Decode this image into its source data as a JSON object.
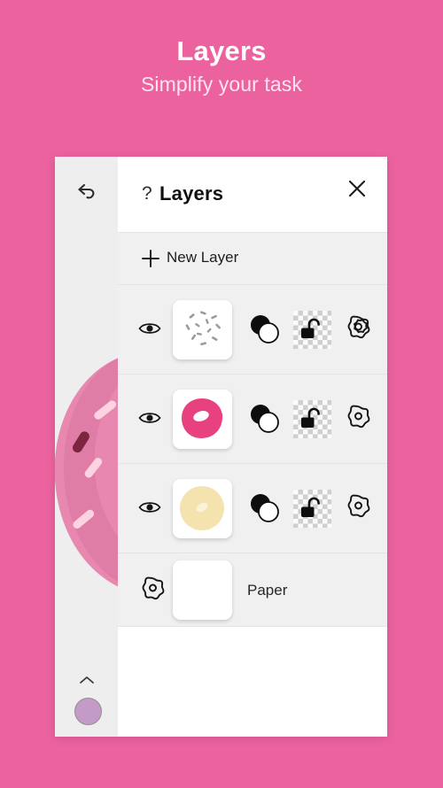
{
  "promo": {
    "title": "Layers",
    "subtitle": "Simplify your task",
    "background_color": "#ec629f",
    "title_color": "#ffffff",
    "subtitle_color": "#fde5ef"
  },
  "toolbar": {
    "undo_icon": "undo-arrow-icon",
    "collapse_icon": "chevron-up-icon",
    "color_swatch": "#c49bc8"
  },
  "panel": {
    "help_glyph": "?",
    "title": "Layers",
    "close_icon": "close-x-icon",
    "new_layer": {
      "icon": "plus-icon",
      "label": "New Layer"
    },
    "layers": [
      {
        "name": "sprinkles-layer",
        "visible_icon": "eye-icon",
        "thumbnail": "sprinkles-thumbnail",
        "blend_icon": "blend-mode-icon",
        "lock_icon": "unlocked-padlock-icon",
        "settings_icon": "gear-icon"
      },
      {
        "name": "pink-icing-layer",
        "visible_icon": "eye-icon",
        "thumbnail": "pink-donut-thumbnail",
        "blend_icon": "blend-mode-icon",
        "lock_icon": "unlocked-padlock-icon",
        "settings_icon": "gear-icon"
      },
      {
        "name": "dough-layer",
        "visible_icon": "eye-icon",
        "thumbnail": "cream-donut-thumbnail",
        "blend_icon": "blend-mode-icon",
        "lock_icon": "unlocked-padlock-icon",
        "settings_icon": "gear-icon"
      }
    ],
    "paper": {
      "settings_icon": "gear-icon",
      "thumbnail": "blank-paper-thumbnail",
      "label": "Paper"
    }
  },
  "canvas": {
    "artwork": "pink-donut-with-sprinkles",
    "icing_color": "#e888b0",
    "icing_shadow": "#d9749f",
    "sprinkle_light": "#fbd3e2",
    "sprinkle_dark": "#7d2540"
  }
}
